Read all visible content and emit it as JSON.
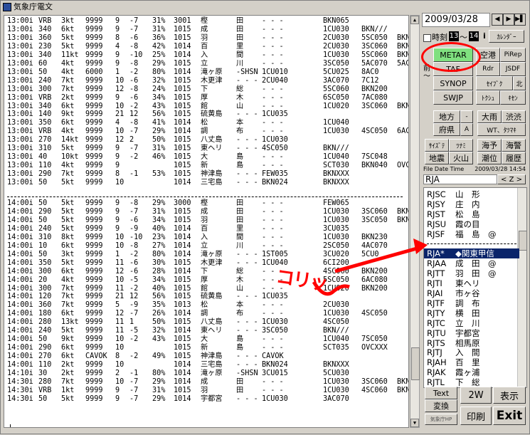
{
  "window": {
    "title": "気象庁電文"
  },
  "lines_top": [
    [
      "13:00i",
      "VRB",
      "3kt",
      "9999",
      "9",
      "-7",
      "31%",
      "3001",
      "樫",
      "田",
      "- - -",
      "BKN065",
      ""
    ],
    [
      "13:00i",
      "340",
      "6kt",
      "9999",
      "9",
      "-7",
      "31%",
      "1015",
      "成",
      "田",
      "- - -",
      "1CU030",
      "BKN///"
    ],
    [
      "13:00i",
      "360",
      "5kt",
      "9999",
      "8",
      "-6",
      "36%",
      "1015",
      "羽",
      "田",
      "- - -",
      "2CU030",
      "5SC050",
      "BKN/"
    ],
    [
      "13:00i",
      "230",
      "5kt",
      "9999",
      "4",
      "-8",
      "42%",
      "1014",
      "百",
      "里",
      "- - -",
      "2CU030",
      "3SC060",
      "BKN/"
    ],
    [
      "13:00i",
      "340",
      "11kt",
      "9999",
      "9",
      "-10",
      "25%",
      "1014",
      "入",
      "間",
      "- - -",
      "1CU030",
      "5SC060",
      "BKN/"
    ],
    [
      "13:00i",
      "60",
      "4kt",
      "9999",
      "9",
      "-8",
      "29%",
      "1015",
      "立",
      "川",
      "- - -",
      "3SC050",
      "5AC070",
      "5AC1"
    ],
    [
      "13:00i",
      "50",
      "4kt",
      "6000",
      "1",
      "-2",
      "80%",
      "1014",
      "滝ヶ原",
      "-SHSN",
      "1CU010",
      "5CU025",
      "8AC0"
    ],
    [
      "13:00i",
      "240",
      "7kt",
      "9999",
      "10",
      "-6",
      "32%",
      "1015",
      "木更津",
      "- - -",
      "2CU040",
      "3AC070",
      "7C12"
    ],
    [
      "13:00i",
      "300",
      "7kt",
      "9999",
      "12",
      "-8",
      "24%",
      "1015",
      "下",
      "総",
      "- - -",
      "5SC060",
      "BKN200",
      ""
    ],
    [
      "13:00i",
      "VRB",
      "2kt",
      "9999",
      "9",
      "-6",
      "34%",
      "1015",
      "厚",
      "木",
      "- - -",
      "6SC050",
      "7AC080",
      ""
    ],
    [
      "13:00i",
      "340",
      "6kt",
      "9999",
      "10",
      "-2",
      "43%",
      "1015",
      "館",
      "山",
      "- - -",
      "1CU020",
      "3SC060",
      "BKN2"
    ],
    [
      "13:00i",
      "140",
      "9kt",
      "9999",
      "21",
      "12",
      "56%",
      "1015",
      "硫黄島",
      "- - -",
      "1CU035",
      "",
      ""
    ],
    [
      "13:00i",
      "350",
      "6kt",
      "9999",
      "4",
      "-8",
      "41%",
      "1014",
      "松",
      "本",
      "- - -",
      "1CU040",
      "",
      ""
    ],
    [
      "13:00i",
      "VRB",
      "4kt",
      "9999",
      "10",
      "-7",
      "29%",
      "1014",
      "調",
      "布",
      "- - -",
      "1CU030",
      "4SC050",
      "6AC0"
    ],
    [
      "13:00i",
      "270",
      "14kt",
      "9999",
      "12",
      "2",
      "50%",
      "1015",
      "八丈島",
      "- - -",
      "1CU030",
      "",
      ""
    ],
    [
      "13:00i",
      "310",
      "5kt",
      "9999",
      "9",
      "-7",
      "31%",
      "1015",
      "東ヘリ",
      "- - -",
      "4SC050",
      "BKN///",
      ""
    ],
    [
      "13:00i",
      "40",
      "10kt",
      "9999",
      "9",
      "-2",
      "46%",
      "1015",
      "大",
      "島",
      "- - -",
      "1CU040",
      "7SC048",
      ""
    ],
    [
      "13:00i",
      "110",
      "4kt",
      "9999",
      "9",
      "",
      "",
      "1015",
      "新",
      "島",
      "- - -",
      "SCT030",
      "BKN040",
      "OVC)"
    ],
    [
      "13:00i",
      "290",
      "7kt",
      "9999",
      "8",
      "-1",
      "53%",
      "1015",
      "神津島",
      "- - -",
      "FEW035",
      "BKNXXX",
      ""
    ],
    [
      "13:00i",
      "50",
      "5kt",
      "9999",
      "10",
      "",
      "",
      "1014",
      "三宅島",
      "- - -",
      "BKN024",
      "BKNXXX",
      ""
    ]
  ],
  "lines_bottom": [
    [
      "14:00i",
      "50",
      "5kt",
      "9999",
      "9",
      "-8",
      "29%",
      "3000",
      "樫",
      "田",
      "- - -",
      "FEW065",
      "",
      ""
    ],
    [
      "14:00i",
      "290",
      "5kt",
      "9999",
      "9",
      "-7",
      "31%",
      "1015",
      "成",
      "田",
      "- - -",
      "1CU030",
      "3SC060",
      "BKN/"
    ],
    [
      "14:00i",
      "50",
      "5kt",
      "9999",
      "9",
      "-6",
      "34%",
      "1015",
      "羽",
      "田",
      "- - -",
      "1CU030",
      "3SC050",
      "BKN/"
    ],
    [
      "14:00i",
      "240",
      "5kt",
      "9999",
      "9",
      "-9",
      "40%",
      "1014",
      "百",
      "里",
      "- - -",
      "3CU035",
      "",
      ""
    ],
    [
      "14:00i",
      "310",
      "8kt",
      "9999",
      "10",
      "-10",
      "23%",
      "1014",
      "入",
      "間",
      "- - -",
      "1CU030",
      "BKN230",
      ""
    ],
    [
      "14:00i",
      "10",
      "6kt",
      "9999",
      "10",
      "-8",
      "27%",
      "1014",
      "立",
      "川",
      "- - -",
      "2SC050",
      "4AC070",
      ""
    ],
    [
      "14:00i",
      "50",
      "3kt",
      "9999",
      "1",
      "-2",
      "80%",
      "1014",
      "滝ヶ原",
      "- - -",
      "1ST005",
      "3CU020",
      "5CU0"
    ],
    [
      "14:00i",
      "350",
      "5kt",
      "9999",
      "11",
      "-6",
      "30%",
      "1015",
      "木更津",
      "- - -",
      "1CU040",
      "6CI200",
      ""
    ],
    [
      "14:00i",
      "300",
      "6kt",
      "9999",
      "12",
      "-6",
      "28%",
      "1014",
      "下",
      "総",
      "- - -",
      "4SC060",
      "BKN200",
      ""
    ],
    [
      "14:00i",
      "20",
      "4kt",
      "9999",
      "10",
      "-5",
      "34%",
      "1015",
      "厚",
      "木",
      "- - -",
      "5SC050",
      "6AC080",
      ""
    ],
    [
      "14:00i",
      "300",
      "7kt",
      "9999",
      "11",
      "-2",
      "40%",
      "1015",
      "館",
      "山",
      "- - -",
      "1CU020",
      "BKN200",
      ""
    ],
    [
      "14:00i",
      "120",
      "7kt",
      "9999",
      "21",
      "12",
      "56%",
      "1015",
      "硫黄島",
      "- - -",
      "1CU035",
      "",
      ""
    ],
    [
      "14:00i",
      "360",
      "7kt",
      "9999",
      "5",
      "-9",
      "35%",
      "1013",
      "松",
      "本",
      "- - -",
      "2CU030",
      "",
      ""
    ],
    [
      "14:00i",
      "180",
      "6kt",
      "9999",
      "12",
      "-7",
      "26%",
      "1014",
      "調",
      "布",
      "- - -",
      "1CU030",
      "4SC050",
      ""
    ],
    [
      "14:00i",
      "280",
      "13kt",
      "9999",
      "11",
      "1",
      "50%",
      "1015",
      "八丈島",
      "- - -",
      "1CU030",
      "4SC050",
      ""
    ],
    [
      "14:00i",
      "240",
      "5kt",
      "9999",
      "11",
      "-5",
      "32%",
      "1014",
      "東ヘリ",
      "- - -",
      "3SC050",
      "BKN///",
      ""
    ],
    [
      "14:00i",
      "50",
      "9kt",
      "9999",
      "10",
      "-2",
      "43%",
      "1015",
      "大",
      "島",
      "- - -",
      "1CU040",
      "7SC050",
      ""
    ],
    [
      "14:00i",
      "290",
      "6kt",
      "9999",
      "10",
      "",
      "",
      "1015",
      "新",
      "島",
      "- - -",
      "SCT035",
      "OVCXXX",
      ""
    ],
    [
      "14:00i",
      "270",
      "6kt",
      "CAVOK",
      "8",
      "-2",
      "49%",
      "1015",
      "神津島",
      "- - -",
      "CAVOK",
      "",
      ""
    ],
    [
      "14:00i",
      "110",
      "2kt",
      "9999",
      "10",
      "",
      "",
      "1014",
      "三宅島",
      "- - -",
      "BKN024",
      "BKNXXX",
      ""
    ],
    [
      "14:10i",
      "30",
      "2kt",
      "9999",
      "2",
      "-1",
      "80%",
      "1014",
      "滝ヶ原",
      "-SHSN",
      "3CU015",
      "5CU030",
      ""
    ],
    [
      "14:30i",
      "280",
      "7kt",
      "9999",
      "10",
      "-7",
      "29%",
      "1014",
      "成",
      "田",
      "- - -",
      "1CU030",
      "3SC060",
      "BKN/"
    ],
    [
      "14:30i",
      "VRB",
      "1kt",
      "9999",
      "9",
      "-7",
      "31%",
      "1015",
      "羽",
      "田",
      "- - -",
      "1CU030",
      "4SC060",
      "BKN/"
    ],
    [
      "14:30i",
      "50",
      "5kt",
      "9999",
      "9",
      "-7",
      "29%",
      "1014",
      "宇都宮",
      "- - -",
      "1CU030",
      "3AC070",
      ""
    ]
  ],
  "panel": {
    "date": "2009/03/28",
    "nav_left": "◀",
    "nav_mid": "▶",
    "nav_right": "▶▌",
    "jikoku_label": "時刻",
    "jikoku_from": "13",
    "jikoku_to": "14",
    "jikoku_tilde": "～",
    "info": "i",
    "calendar": "ｶﾚﾝﾀﾞｰ",
    "metar": "METAR",
    "kuko": "空港",
    "pirep": "PiRep",
    "taf": "TAF",
    "rdr": "Rdr",
    "jsdf": "JSDF",
    "mae_label": "前",
    "mae_sub": "～",
    "synop": "SYNOP",
    "seifu": "ｾｲﾌﾞｸ",
    "kita": "北",
    "swjp": "SWJP",
    "tokushu": "ﾄｸｼｭ",
    "kisen": "ｷｾﾝ",
    "chiho": "地方",
    "chiho_sub": "-",
    "omichi": "大雨",
    "shibu": "渋渋",
    "fuken": "府県",
    "fuken_sub": "A",
    "wt": "WT、ﾀﾂﾏｷ",
    "saikuro": "ｻｲｽﾞﾃ",
    "tsunami": "ﾂﾅﾐ",
    "kaiyo": "海予",
    "kaijo": "海警",
    "jishin": "地震",
    "kazan": "火山",
    "choi": "潮位",
    "rireki": "履歴",
    "filedate_label": "File Date Time",
    "filedate_value": "2009/03/28 14:54",
    "code_input": "RJA",
    "code_btn": "< Z >",
    "text_btn": "Text",
    "twow_btn": "2W",
    "hyoji_btn": "表示",
    "henkan_btn": "変換",
    "kisho_btn": "気象庁HP",
    "insatsu_btn": "印刷",
    "exit_btn": "Exit"
  },
  "station_list": [
    [
      "RJSC",
      "山　形"
    ],
    [
      "RJSY",
      "庄　内"
    ],
    [
      "RJST",
      "松　島"
    ],
    [
      "RJSU",
      "霞の目"
    ],
    [
      "RJSF",
      "福　島　@"
    ],
    [
      "",
      ""
    ],
    [
      "RJA*",
      "◆関東甲信"
    ],
    [
      "RJAA",
      "成　田　@"
    ],
    [
      "RJTT",
      "羽　田　@"
    ],
    [
      "RJTI",
      "東ヘリ"
    ],
    [
      "RJAI",
      "市ヶ谷"
    ],
    [
      "RJTF",
      "調　布"
    ],
    [
      "RJTY",
      "横　田"
    ],
    [
      "RJTC",
      "立　川"
    ],
    [
      "RJTU",
      "宇都宮"
    ],
    [
      "RJTS",
      "相馬原"
    ],
    [
      "RJTJ",
      "入　間"
    ],
    [
      "RJAH",
      "百　里"
    ],
    [
      "RJAK",
      "霞ヶ浦"
    ],
    [
      "RJTL",
      "下　総"
    ]
  ],
  "annotation": {
    "text": "コリッ",
    "color": "#ff0000"
  },
  "accent": {
    "metar_green": "#7fe07f",
    "selection": "#0a246a",
    "annotation_red": "#ff0000"
  }
}
